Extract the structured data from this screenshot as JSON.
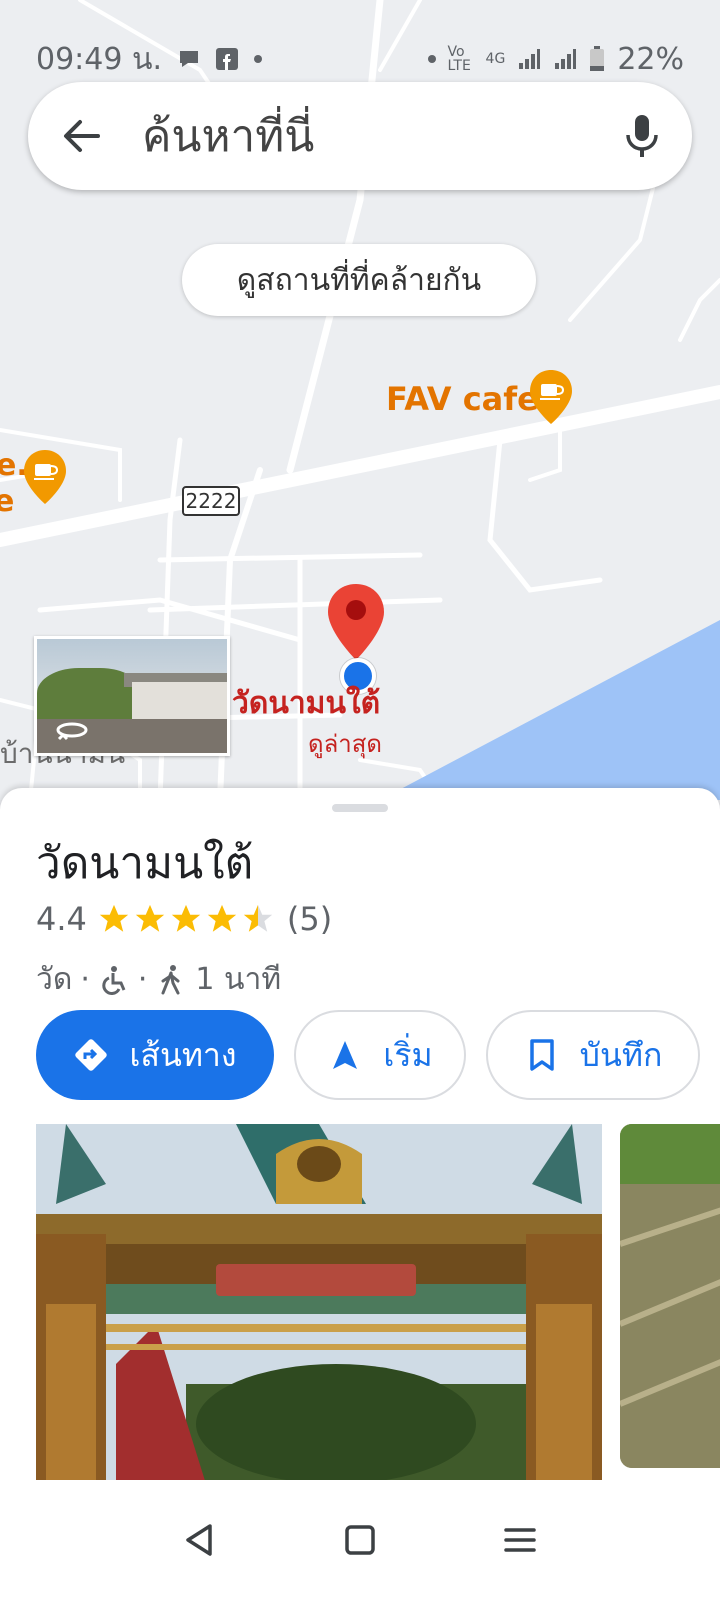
{
  "status_bar": {
    "time": "09:49 น.",
    "battery": "22%",
    "network": "4G",
    "volte": "Vo LTE"
  },
  "search": {
    "placeholder": "ค้นหาที่นี่"
  },
  "map": {
    "similar_places_button": "ดูสถานที่ที่คล้ายกัน",
    "poi_cafe": "FAV cafe",
    "poi_cut_text": "e.",
    "poi_cut_text2": "e",
    "road_number": "2222",
    "place_label": "วัดนามนใต้",
    "place_sublabel": "ดูล่าสุด",
    "village_label": "บ้านนามน"
  },
  "place": {
    "title": "วัดนามนใต้",
    "rating": "4.4",
    "stars": 4.4,
    "review_count": "(5)",
    "category": "วัด",
    "separator": "·",
    "walk_time": "1 นาที"
  },
  "actions": {
    "directions": "เส้นทาง",
    "start": "เริ่ม",
    "save": "บันทึก"
  },
  "colors": {
    "accent": "#1a73e8",
    "star": "#fbbc04",
    "pin": "#ea4335",
    "poi": "#e37400",
    "water": "#9ec3f7"
  }
}
